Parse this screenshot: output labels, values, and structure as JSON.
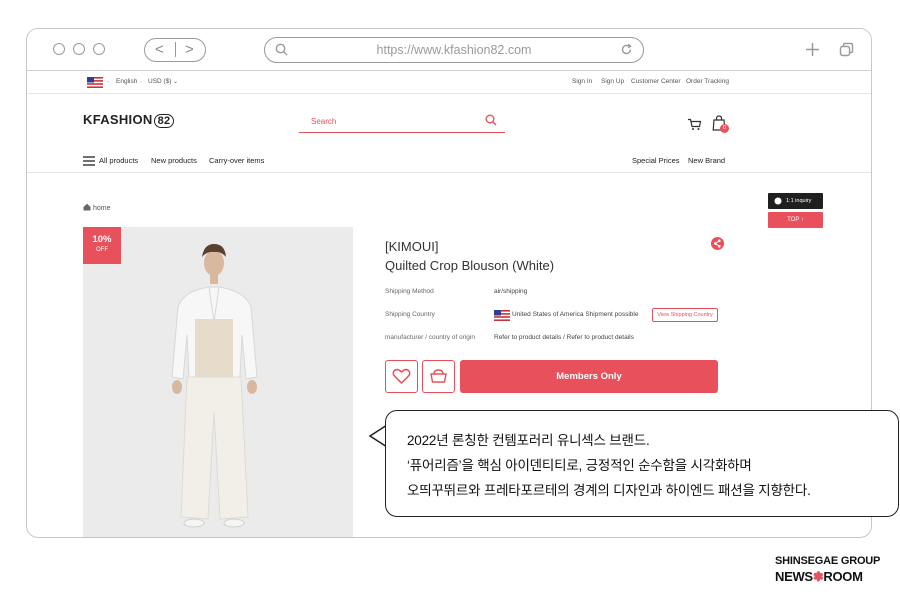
{
  "browser": {
    "url": "https://www.kfashion82.com",
    "nav_back": "<",
    "nav_forward": ">"
  },
  "utility_bar": {
    "language": "English",
    "currency": "USD ($)",
    "links": [
      "Sign In",
      "Sign Up",
      "Customer Center",
      "Order Tracking"
    ]
  },
  "header": {
    "logo_text": "KFASHION",
    "logo_number": "82",
    "search_placeholder": "Search",
    "cart_count": "0"
  },
  "category_nav": {
    "left": [
      "All products",
      "New products",
      "Carry-over items"
    ],
    "right": [
      "Special Prices",
      "New Brand"
    ]
  },
  "breadcrumb": "home",
  "product": {
    "discount": "10%",
    "discount_label": "OFF",
    "brand": "[KIMOUI]",
    "name": "Quilted Crop Blouson (White)",
    "details": [
      {
        "label": "Shipping Method",
        "value": "air/shipping"
      },
      {
        "label": "Shipping Country",
        "value": "United States of America  Shipment possible"
      },
      {
        "label": "manufacturer / country of origin",
        "value": "Refer to product details / Refer to product details"
      }
    ],
    "view_shipping_label": "View Shipping Country",
    "members_button": "Members Only"
  },
  "side_buttons": {
    "inquiry": "1:1 inquiry",
    "top": "TOP ↑"
  },
  "callout": {
    "lines": [
      "2022년 론칭한 컨템포러리 유니섹스 브랜드.",
      "‘퓨어리즘’을 핵심 아이덴티티로, 긍정적인 순수함을 시각화하며",
      "오띄꾸뛰르와 프레타포르테의 경계의 디자인과 하이엔드 패션을 지향한다."
    ]
  },
  "footer_brand": {
    "line1": "SHINSEGAE GROUP",
    "line2_a": "NEWS",
    "line2_b": "ROOM"
  },
  "colors": {
    "accent": "#e8505b",
    "dark": "#1f1f1f"
  }
}
